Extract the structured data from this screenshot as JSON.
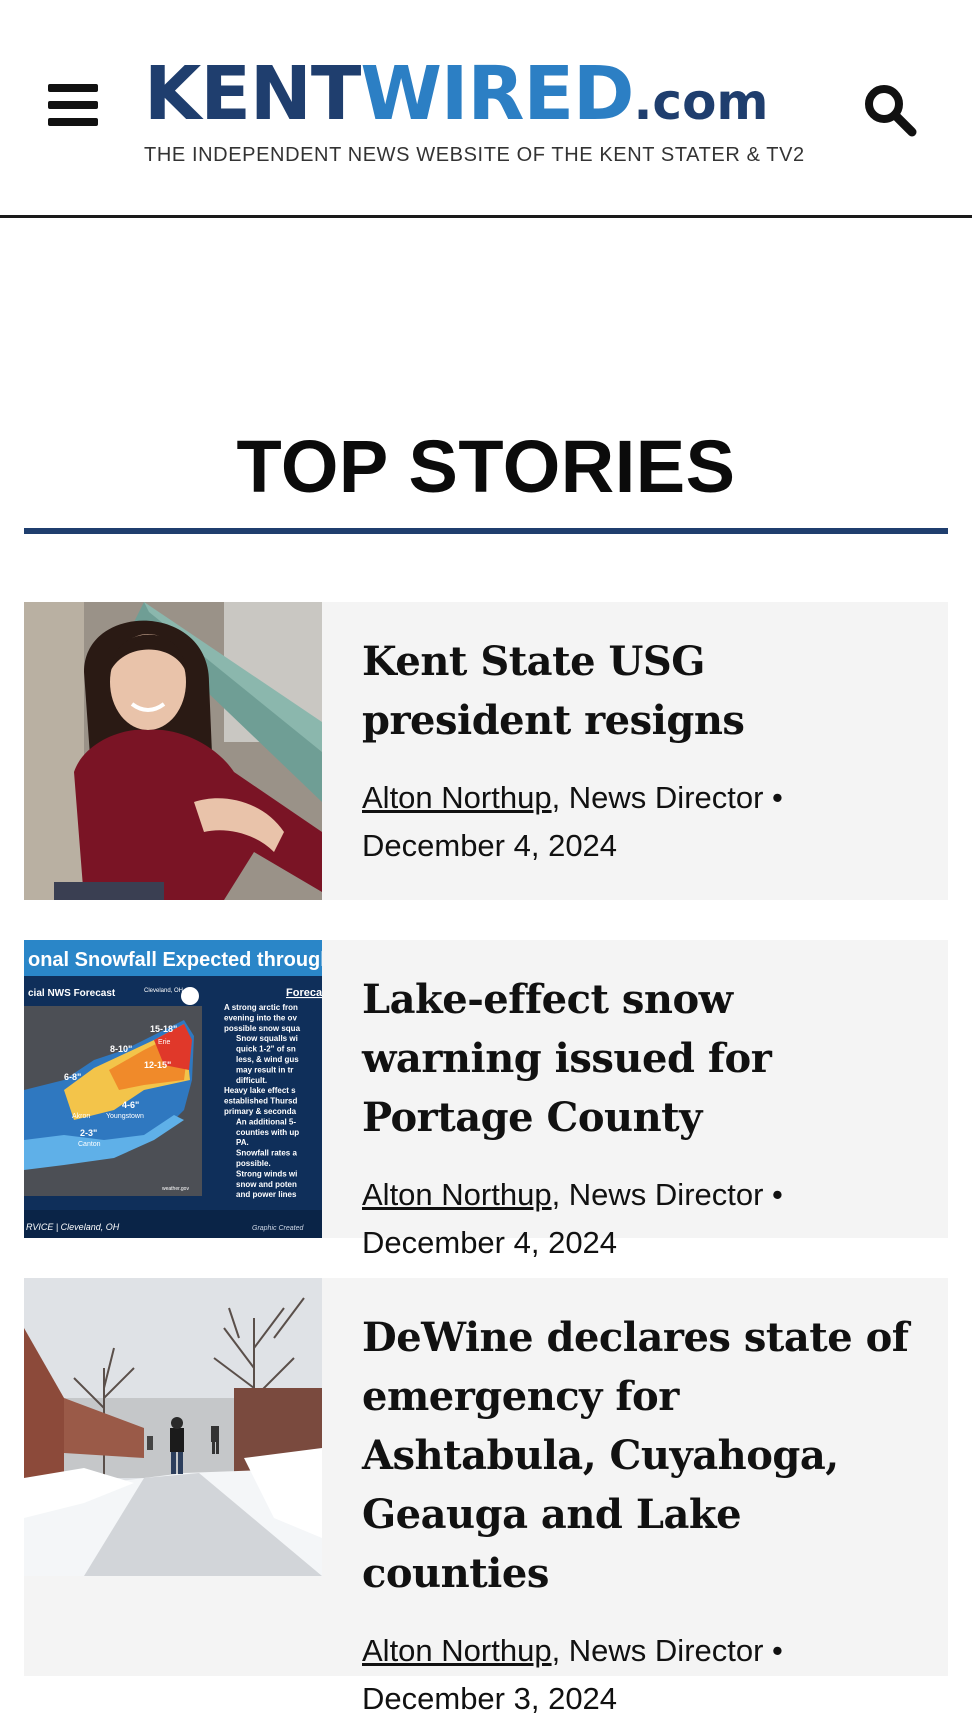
{
  "header": {
    "logo_kent": "KENT",
    "logo_wired": "WIRED",
    "logo_com": ".com",
    "tagline": "THE INDEPENDENT NEWS WEBSITE OF THE KENT STATER & TV2",
    "menu_icon": "hamburger-menu-icon",
    "search_icon": "search-icon"
  },
  "section": {
    "title": "TOP STORIES"
  },
  "colors": {
    "brand_dark": "#1f3e6e",
    "brand_light": "#2c7fc4",
    "card_bg": "#f4f4f4"
  },
  "stories": [
    {
      "title": "Kent State USG president resigns",
      "author": "Alton Northup",
      "role": ", News Director •",
      "date": "December 4, 2024"
    },
    {
      "title": "Lake-effect snow warning issued for Portage County",
      "author": "Alton Northup",
      "role": ", News Director •",
      "date": "December 4, 2024",
      "image_text": {
        "banner": "onal Snowfall Expected through",
        "subtitle": "cial NWS Forecast",
        "office": "Cleveland, OH",
        "forecast_head": "Foreca",
        "label_1518": "15-18\"",
        "label_810": "8-10\"",
        "label_1215": "12-15\"",
        "label_erie": "Erie",
        "label_68": "6-8\"",
        "label_46": "4-6\"",
        "label_23": "2-3\"",
        "city_akron": "Akron",
        "city_youngstown": "Youngstown",
        "city_canton": "Canton",
        "footer_office": "RVICE | Cleveland, OH",
        "credit": "Graphic Created",
        "weather_gov": "weather.gov",
        "bullets": [
          "A strong arctic fron",
          "evening into the ov",
          "possible snow squa",
          "Snow squalls wi",
          "quick 1-2\" of sn",
          "less, & wind gus",
          "may result in tr",
          "difficult.",
          "Heavy lake effect s",
          "established Thursd",
          "primary & seconda",
          "An additional 5-",
          "counties with up",
          "PA.",
          "Snowfall rates a",
          "possible.",
          "Strong winds wi",
          "snow and poten",
          "and power lines"
        ]
      }
    },
    {
      "title": "DeWine declares state of emergency for Ashtabula, Cuyahoga, Geauga and Lake counties",
      "author": "Alton Northup",
      "role": ", News Director •",
      "date": "December 3, 2024"
    }
  ]
}
